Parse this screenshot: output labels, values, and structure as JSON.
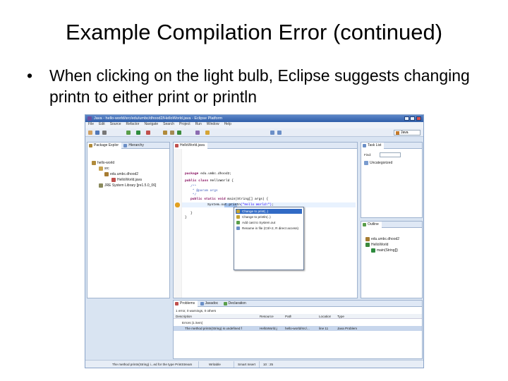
{
  "slide": {
    "title": "Example Compilation Error (continued)",
    "bullet_marker": "•",
    "bullet_text": "When clicking on the light bulb, Eclipse suggests changing printn to either print or println"
  },
  "eclipse": {
    "window_title": "Java - hello-world/src/edu/umbc/dhood2/HelloWorld.java - Eclipse Platform",
    "menu": [
      "File",
      "Edit",
      "Source",
      "Refactor",
      "Navigate",
      "Search",
      "Project",
      "Run",
      "Window",
      "Help"
    ],
    "perspective": "Java",
    "package_explorer": {
      "tabs": [
        "Package Explor",
        "Hierarchy"
      ],
      "tree": [
        "hello-world",
        "src",
        "edu.umbc.dhood2",
        "HelloWorld.java",
        "JRE System Library [jre1.5.0_06]"
      ]
    },
    "editor": {
      "tab": "HelloWorld.java",
      "lines": [
        {
          "parts": [
            [
              "kw",
              "package"
            ],
            [
              "",
              "edu.umbc.dhood2;"
            ]
          ]
        },
        {
          "parts": [
            [
              "kw",
              "public class"
            ],
            [
              "",
              "HelloWorld {"
            ]
          ]
        },
        {
          "parts": [
            [
              "cm",
              "/**"
            ]
          ]
        },
        {
          "parts": [
            [
              "cm",
              " * @param args"
            ]
          ]
        },
        {
          "parts": [
            [
              "cm",
              " */"
            ]
          ]
        },
        {
          "parts": [
            [
              "kw",
              "public static void"
            ],
            [
              "",
              "main(String[] args) {"
            ]
          ]
        },
        {
          "parts": [
            [
              "",
              "System."
            ],
            [
              "",
              "out"
            ],
            [
              "",
              "."
            ],
            [
              "",
              "printn"
            ],
            [
              "st",
              "(\"Hello World!\")"
            ],
            [
              "",
              ";"
            ]
          ]
        },
        {
          "parts": [
            [
              "",
              "}"
            ]
          ]
        },
        {
          "parts": [
            [
              "",
              "}"
            ]
          ]
        }
      ]
    },
    "quickfix": [
      "Change to print(..)",
      "Change to println(..)",
      "Add cast to System.out",
      "Rename in file (Ctrl+2, R direct access)"
    ],
    "tasklist": {
      "tab": "Task List",
      "find_label": "Find:",
      "item": "Uncategorized"
    },
    "outline": {
      "tab": "Outline",
      "items": [
        "edu.umbc.dhood2",
        "HelloWorld",
        "main(String[])"
      ]
    },
    "problems": {
      "tabs": [
        "Problems",
        "Javadoc",
        "Declaration"
      ],
      "summary": "1 error, 0 warnings, 0 others",
      "headers": [
        "Description",
        "Resource",
        "Path",
        "Location",
        "Type"
      ],
      "group": "Errors (1 item)",
      "row": [
        "The method printn(String) is undefined f",
        "HelloWorld.j",
        "hello-world/src/...",
        "line 11",
        "Java Problem"
      ]
    },
    "status": {
      "message": "The method printn(String) i...ed for the type PrintStream",
      "mode": "Writable",
      "insert": "Smart Insert",
      "position": "10 : 25"
    }
  }
}
